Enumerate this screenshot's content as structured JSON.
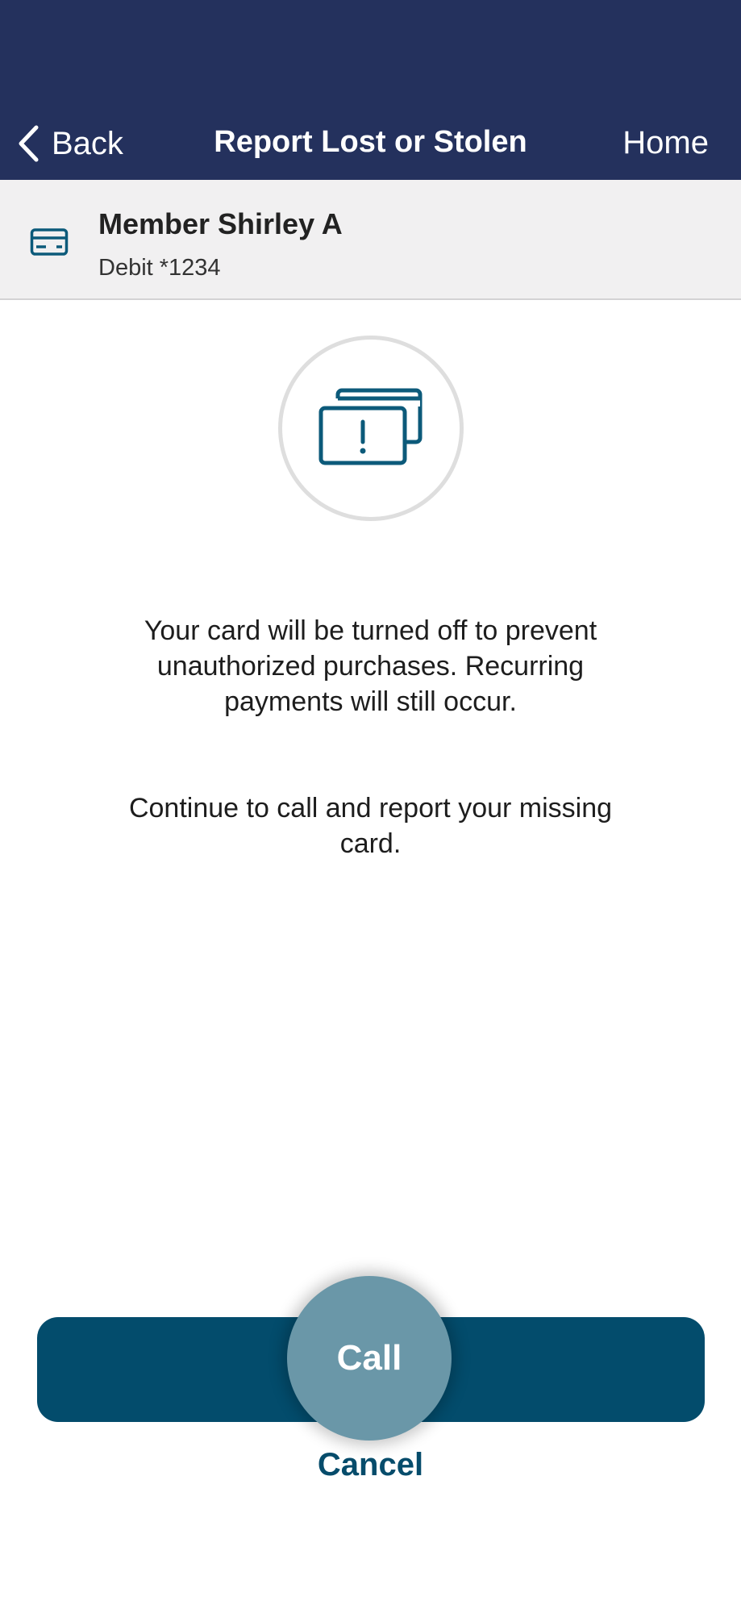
{
  "nav": {
    "back_label": "Back",
    "title": "Report Lost or Stolen",
    "home_label": "Home"
  },
  "account": {
    "name": "Member Shirley A",
    "card_label": "Debit *1234"
  },
  "messages": {
    "info": "Your card will be turned off to prevent unauthorized purchases. Recurring payments will still occur.",
    "instruction": "Continue to call and report your missing card."
  },
  "actions": {
    "call_label": "Call",
    "cancel_label": "Cancel"
  },
  "colors": {
    "nav_background": "#24315d",
    "primary": "#034c6c",
    "account_background": "#f1f0f1"
  },
  "icons": {
    "back": "chevron-left-icon",
    "account": "credit-card-icon",
    "hero": "card-alert-icon"
  }
}
